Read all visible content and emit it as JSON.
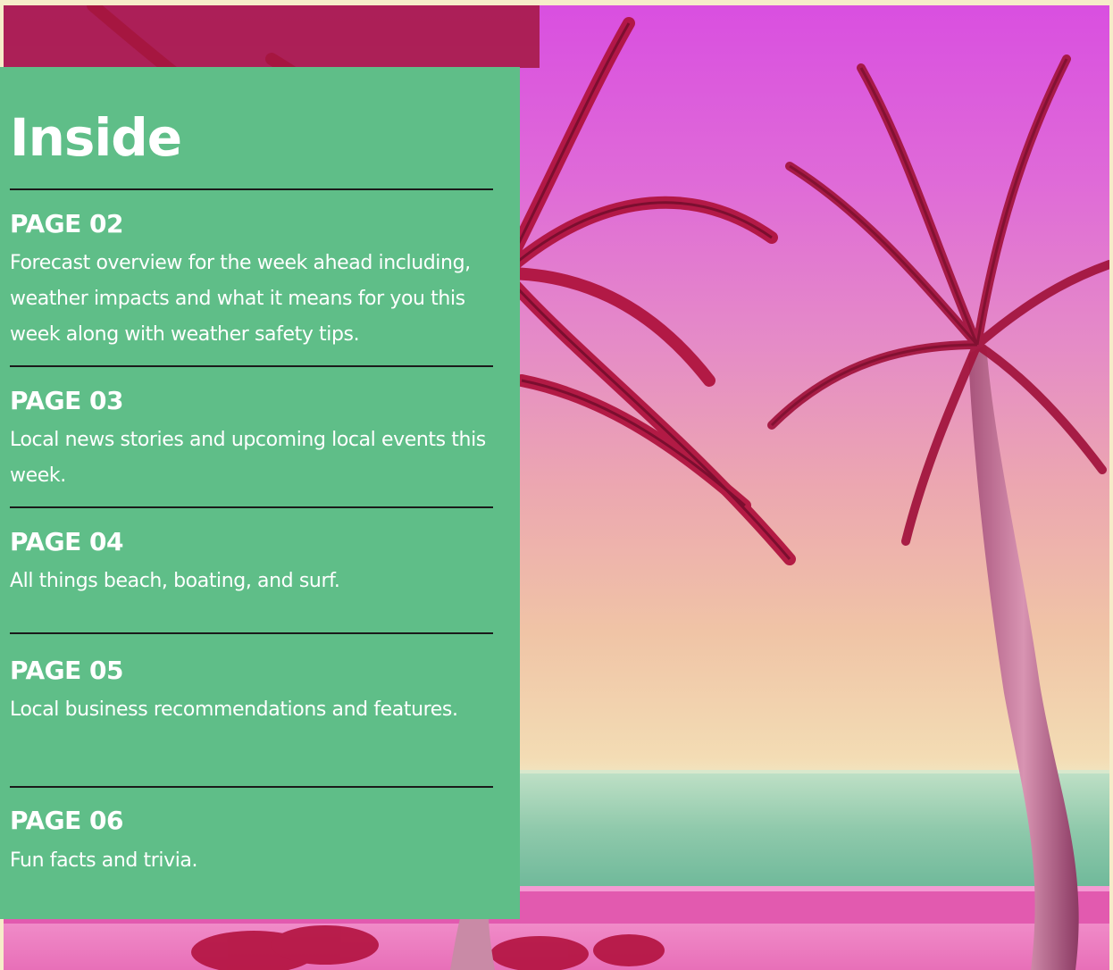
{
  "title": "Inside",
  "entries": [
    {
      "page": "PAGE 02",
      "description": "Forecast overview for the week ahead including, weather impacts and what it means for you this week along with weather safety tips."
    },
    {
      "page": "PAGE 03",
      "description": "Local news stories and upcoming local events this week."
    },
    {
      "page": "PAGE 04",
      "description": "All things beach, boating, and surf."
    },
    {
      "page": "PAGE 05",
      "description": "Local business recommendations and features."
    },
    {
      "page": "PAGE 06",
      "description": "Fun facts and trivia."
    }
  ],
  "colors": {
    "panel": "#5fbe88",
    "rule": "#1a1a1a",
    "text": "#ffffff",
    "page_border": "#f6ecc9"
  }
}
